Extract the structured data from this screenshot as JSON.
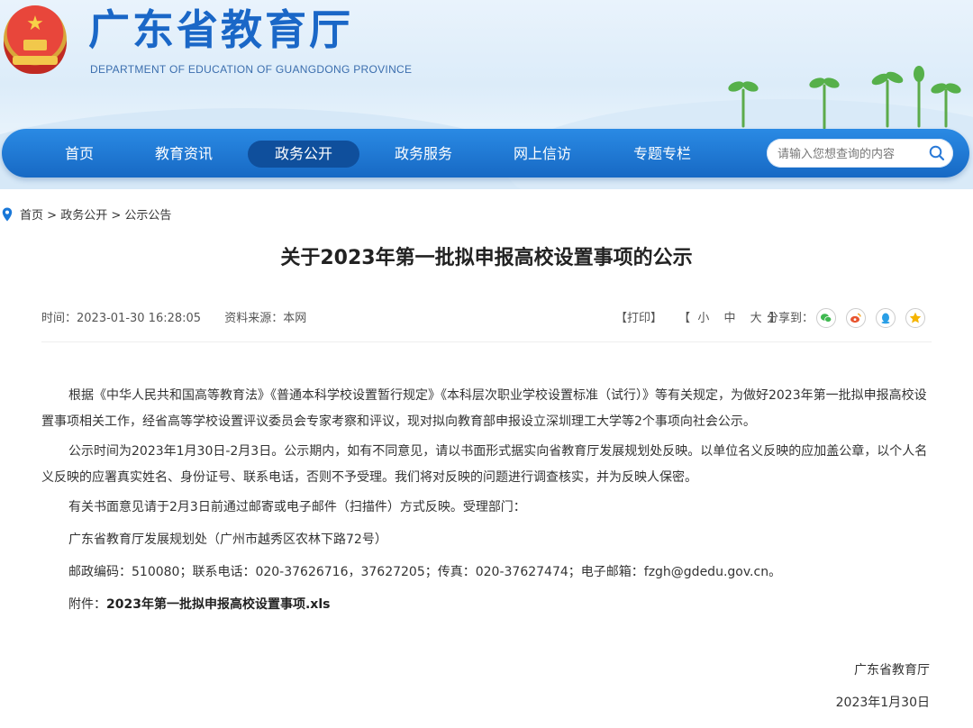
{
  "header": {
    "site_title": "广东省教育厅",
    "site_subtitle": "DEPARTMENT OF EDUCATION OF GUANGDONG PROVINCE"
  },
  "nav": {
    "items": [
      {
        "label": "首页",
        "active": false
      },
      {
        "label": "教育资讯",
        "active": false
      },
      {
        "label": "政务公开",
        "active": true
      },
      {
        "label": "政务服务",
        "active": false
      },
      {
        "label": "网上信访",
        "active": false
      },
      {
        "label": "专题专栏",
        "active": false
      }
    ],
    "search_placeholder": "请输入您想查询的内容"
  },
  "breadcrumb": {
    "items": [
      "首页",
      "政务公开",
      "公示公告"
    ],
    "separator": ">"
  },
  "article": {
    "title": "关于2023年第一批拟申报高校设置事项的公示",
    "time": "时间：2023-01-30 16:28:05",
    "source": "资料来源：本网",
    "print": "【打印】",
    "size_open": "【",
    "size_small": "小",
    "size_medium": "中",
    "size_large": "大",
    "size_close": "】",
    "share_label": "分享到：",
    "share_icons": [
      "wechat-icon",
      "weibo-icon",
      "qq-icon",
      "qzone-icon"
    ],
    "paragraphs": [
      "根据《中华人民共和国高等教育法》《普通本科学校设置暂行规定》《本科层次职业学校设置标准（试行）》等有关规定，为做好2023年第一批拟申报高校设置事项相关工作，经省高等学校设置评议委员会专家考察和评议，现对拟向教育部申报设立深圳理工大学等2个事项向社会公示。",
      "公示时间为2023年1月30日-2月3日。公示期内，如有不同意见，请以书面形式据实向省教育厅发展规划处反映。以单位名义反映的应加盖公章，以个人名义反映的应署真实姓名、身份证号、联系电话，否则不予受理。我们将对反映的问题进行调查核实，并为反映人保密。",
      "有关书面意见请于2月3日前通过邮寄或电子邮件（扫描件）方式反映。受理部门：",
      "广东省教育厅发展规划处（广州市越秀区农林下路72号）",
      "邮政编码：510080；联系电话：020-37626716，37627205；传真：020-37627474；电子邮箱：fzgh@gdedu.gov.cn。"
    ],
    "attachment_label": "附件：",
    "attachment_name": "2023年第一批拟申报高校设置事项.xls",
    "signature": "广东省教育厅",
    "date": "2023年1月30日"
  },
  "colors": {
    "brand_blue": "#1a67c7",
    "nav_active": "#0f4f9c",
    "wechat": "#3fb950",
    "weibo": "#e8542f",
    "qq": "#2a9fe6",
    "qzone": "#f5b400"
  }
}
